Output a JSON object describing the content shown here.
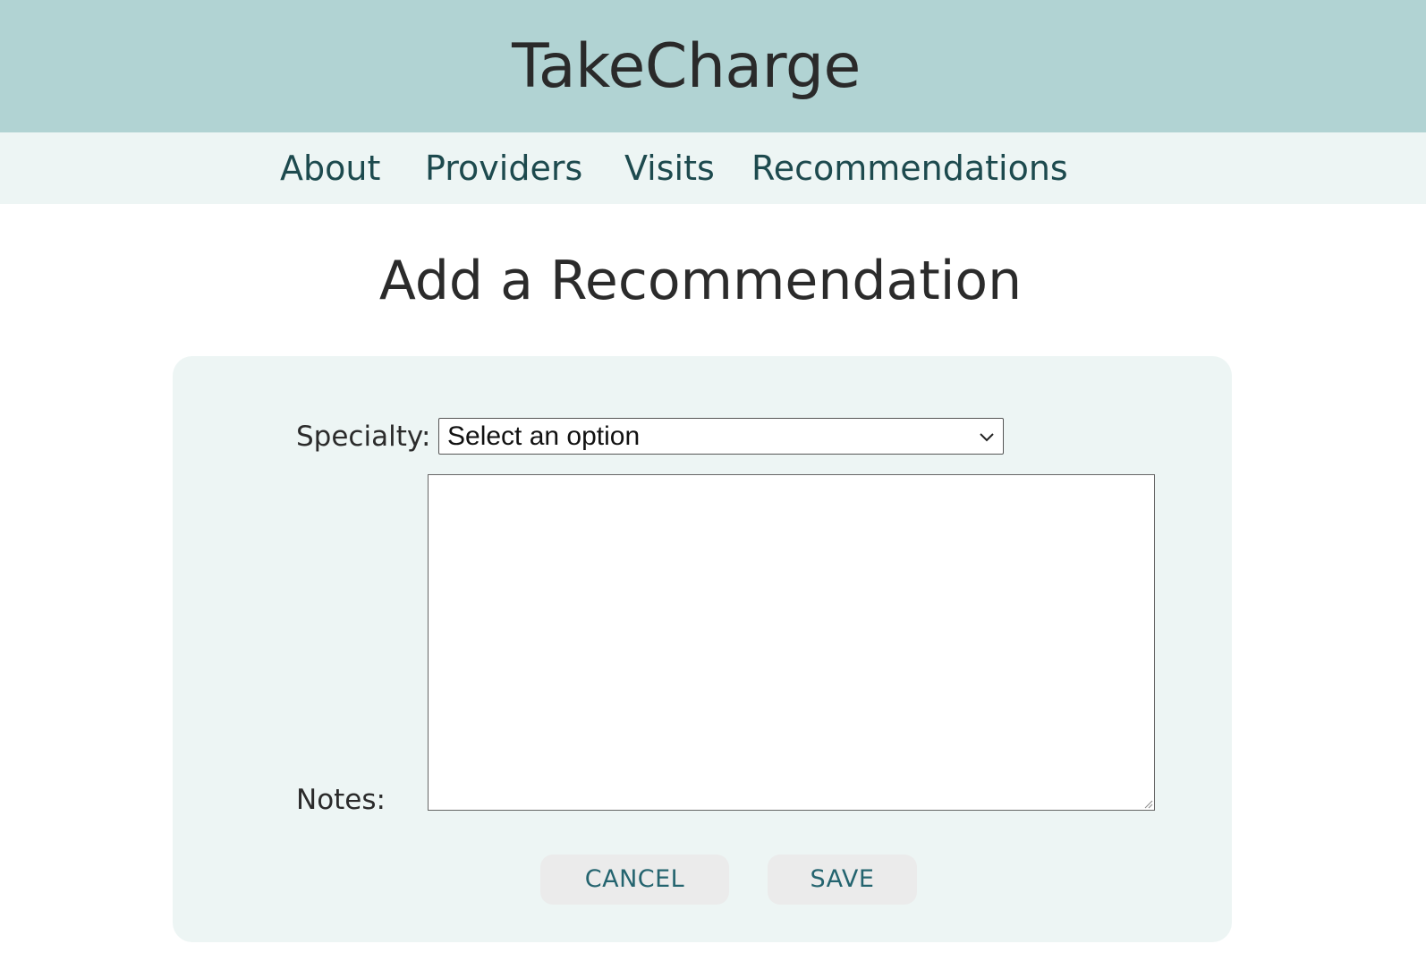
{
  "app": {
    "title": "TakeCharge"
  },
  "nav": {
    "items": [
      {
        "label": "About"
      },
      {
        "label": "Providers"
      },
      {
        "label": "Visits"
      },
      {
        "label": "Recommendations"
      }
    ]
  },
  "page": {
    "title": "Add a Recommendation"
  },
  "form": {
    "specialty_label": "Specialty:",
    "specialty_value": "Select an option",
    "notes_label": "Notes:",
    "notes_value": "",
    "cancel_label": "CANCEL",
    "save_label": "SAVE"
  },
  "colors": {
    "header_bg": "#b1d3d3",
    "nav_bg": "#edf5f4",
    "card_bg": "#edf5f4",
    "button_bg": "#ebebeb",
    "button_text": "#24646f",
    "nav_text": "#1d4a4e"
  },
  "icons": {
    "select_arrow": "chevron-down-icon",
    "textarea_resize": "resize-handle-icon"
  }
}
